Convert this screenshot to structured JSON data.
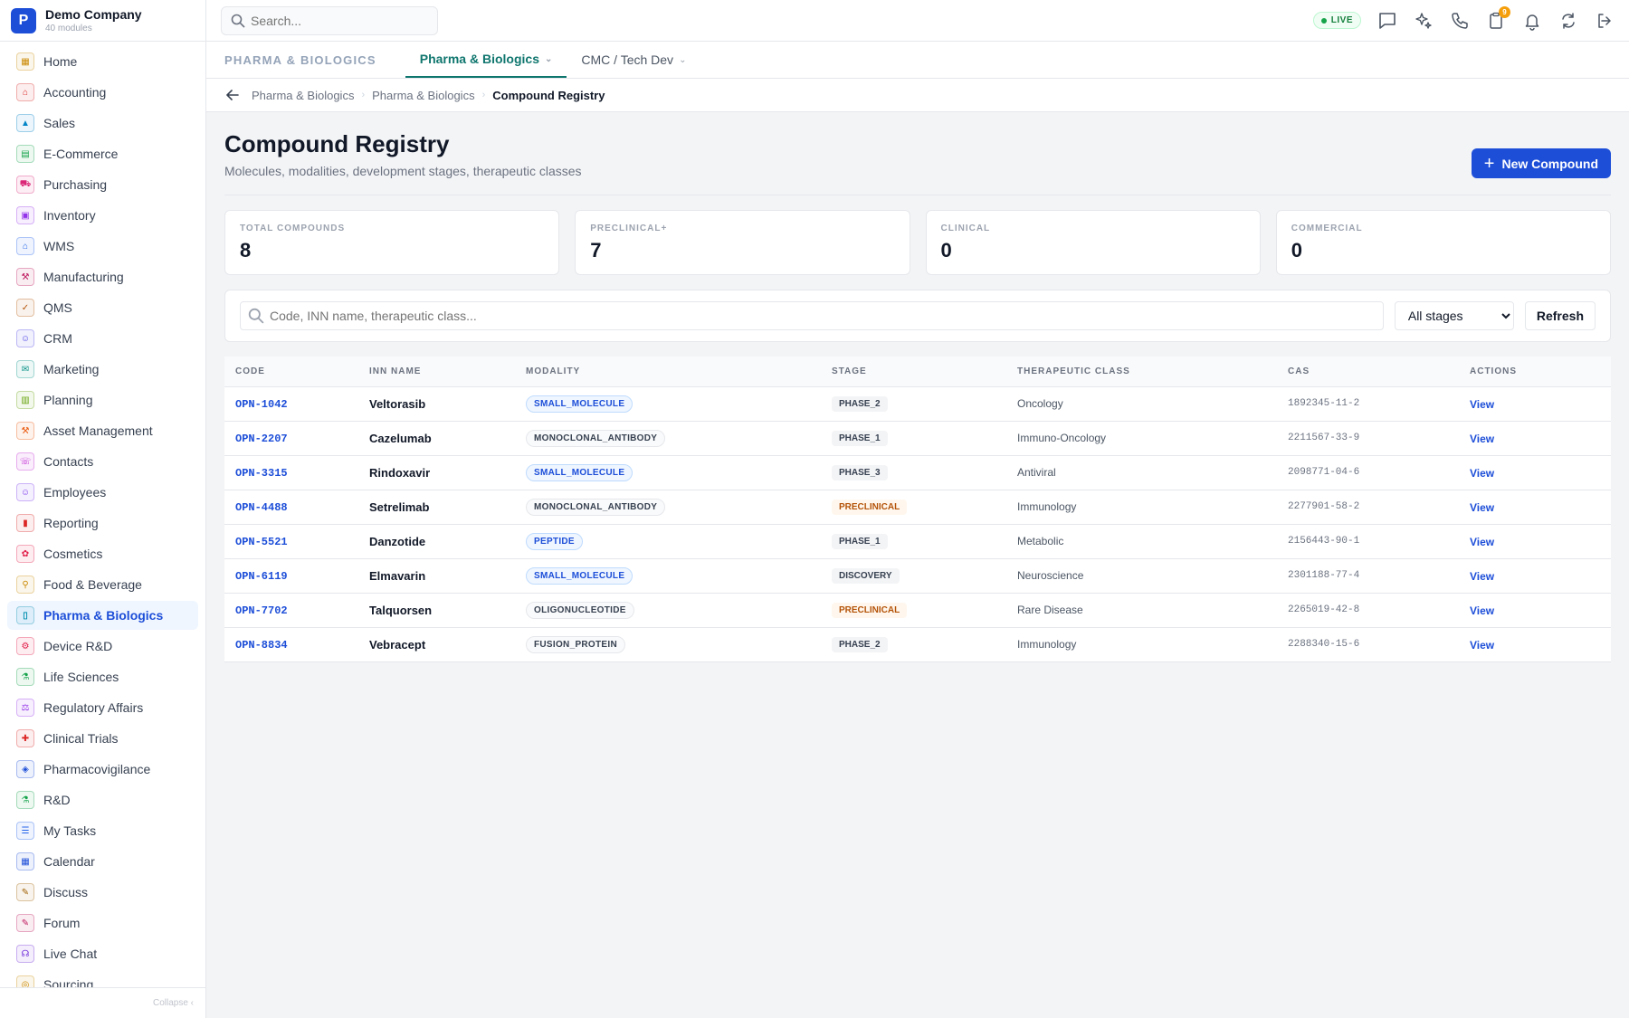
{
  "brand": {
    "logo_letter": "P",
    "name": "Demo Company",
    "sub": "40 modules"
  },
  "sidebar": {
    "items": [
      {
        "label": "Home",
        "color": "#ca8a04",
        "glyph": "▦"
      },
      {
        "label": "Accounting",
        "color": "#dc2626",
        "glyph": "⌂"
      },
      {
        "label": "Sales",
        "color": "#0284c7",
        "glyph": "▲"
      },
      {
        "label": "E-Commerce",
        "color": "#16a34a",
        "glyph": "▤"
      },
      {
        "label": "Purchasing",
        "color": "#db2777",
        "glyph": "⛟"
      },
      {
        "label": "Inventory",
        "color": "#9333ea",
        "glyph": "▣"
      },
      {
        "label": "WMS",
        "color": "#2563eb",
        "glyph": "⌂"
      },
      {
        "label": "Manufacturing",
        "color": "#be185d",
        "glyph": "⚒"
      },
      {
        "label": "QMS",
        "color": "#b45309",
        "glyph": "✓"
      },
      {
        "label": "CRM",
        "color": "#4f46e5",
        "glyph": "☺"
      },
      {
        "label": "Marketing",
        "color": "#0d9488",
        "glyph": "✉"
      },
      {
        "label": "Planning",
        "color": "#65a30d",
        "glyph": "▥"
      },
      {
        "label": "Asset Management",
        "color": "#ea580c",
        "glyph": "⚒"
      },
      {
        "label": "Contacts",
        "color": "#c026d3",
        "glyph": "☏"
      },
      {
        "label": "Employees",
        "color": "#7c3aed",
        "glyph": "☺"
      },
      {
        "label": "Reporting",
        "color": "#dc2626",
        "glyph": "▮"
      },
      {
        "label": "Cosmetics",
        "color": "#e11d48",
        "glyph": "✿"
      },
      {
        "label": "Food & Beverage",
        "color": "#ca8a04",
        "glyph": "⚲"
      },
      {
        "label": "Pharma & Biologics",
        "color": "#0891b2",
        "glyph": "▯",
        "active": true
      },
      {
        "label": "Device R&D",
        "color": "#e11d48",
        "glyph": "⚙"
      },
      {
        "label": "Life Sciences",
        "color": "#16a34a",
        "glyph": "⚗"
      },
      {
        "label": "Regulatory Affairs",
        "color": "#9333ea",
        "glyph": "⚖"
      },
      {
        "label": "Clinical Trials",
        "color": "#dc2626",
        "glyph": "✚"
      },
      {
        "label": "Pharmacovigilance",
        "color": "#1d4ed8",
        "glyph": "◈"
      },
      {
        "label": "R&D",
        "color": "#16a34a",
        "glyph": "⚗"
      },
      {
        "label": "My Tasks",
        "color": "#2563eb",
        "glyph": "☰"
      },
      {
        "label": "Calendar",
        "color": "#1d4ed8",
        "glyph": "▦"
      },
      {
        "label": "Discuss",
        "color": "#a16207",
        "glyph": "✎"
      },
      {
        "label": "Forum",
        "color": "#be185d",
        "glyph": "✎"
      },
      {
        "label": "Live Chat",
        "color": "#6d28d9",
        "glyph": "☊"
      },
      {
        "label": "Sourcing",
        "color": "#ca8a04",
        "glyph": "◎"
      }
    ],
    "collapse_label": "Collapse ‹"
  },
  "topbar": {
    "search_placeholder": "Search...",
    "live_label": "LIVE",
    "notification_count": "9"
  },
  "tabs": {
    "section": "PHARMA & BIOLOGICS",
    "items": [
      {
        "label": "Pharma & Biologics",
        "active": true
      },
      {
        "label": "CMC / Tech Dev",
        "active": false
      }
    ]
  },
  "breadcrumb": [
    "Pharma & Biologics",
    "Pharma & Biologics",
    "Compound Registry"
  ],
  "page": {
    "title": "Compound Registry",
    "subtitle": "Molecules, modalities, development stages, therapeutic classes",
    "new_button": "New Compound"
  },
  "stats": [
    {
      "label": "TOTAL COMPOUNDS",
      "value": "8"
    },
    {
      "label": "PRECLINICAL+",
      "value": "7"
    },
    {
      "label": "CLINICAL",
      "value": "0"
    },
    {
      "label": "COMMERCIAL",
      "value": "0"
    }
  ],
  "filter": {
    "search_placeholder": "Code, INN name, therapeutic class...",
    "stage_selected": "All stages",
    "refresh_label": "Refresh"
  },
  "table": {
    "headers": [
      "CODE",
      "INN NAME",
      "MODALITY",
      "STAGE",
      "THERAPEUTIC CLASS",
      "CAS",
      "ACTIONS"
    ],
    "rows": [
      {
        "code": "OPN-1042",
        "inn": "Veltorasib",
        "modality": "SMALL_MOLECULE",
        "stage": "PHASE_2",
        "ther": "Oncology",
        "cas": "1892345-11-2",
        "action": "View"
      },
      {
        "code": "OPN-2207",
        "inn": "Cazelumab",
        "modality": "MONOCLONAL_ANTIBODY",
        "stage": "PHASE_1",
        "ther": "Immuno-Oncology",
        "cas": "2211567-33-9",
        "action": "View"
      },
      {
        "code": "OPN-3315",
        "inn": "Rindoxavir",
        "modality": "SMALL_MOLECULE",
        "stage": "PHASE_3",
        "ther": "Antiviral",
        "cas": "2098771-04-6",
        "action": "View"
      },
      {
        "code": "OPN-4488",
        "inn": "Setrelimab",
        "modality": "MONOCLONAL_ANTIBODY",
        "stage": "PRECLINICAL",
        "ther": "Immunology",
        "cas": "2277901-58-2",
        "action": "View"
      },
      {
        "code": "OPN-5521",
        "inn": "Danzotide",
        "modality": "PEPTIDE",
        "stage": "PHASE_1",
        "ther": "Metabolic",
        "cas": "2156443-90-1",
        "action": "View"
      },
      {
        "code": "OPN-6119",
        "inn": "Elmavarin",
        "modality": "SMALL_MOLECULE",
        "stage": "DISCOVERY",
        "ther": "Neuroscience",
        "cas": "2301188-77-4",
        "action": "View"
      },
      {
        "code": "OPN-7702",
        "inn": "Talquorsen",
        "modality": "OLIGONUCLEOTIDE",
        "stage": "PRECLINICAL",
        "ther": "Rare Disease",
        "cas": "2265019-42-8",
        "action": "View"
      },
      {
        "code": "OPN-8834",
        "inn": "Vebracept",
        "modality": "FUSION_PROTEIN",
        "stage": "PHASE_2",
        "ther": "Immunology",
        "cas": "2288340-15-6",
        "action": "View"
      }
    ]
  }
}
